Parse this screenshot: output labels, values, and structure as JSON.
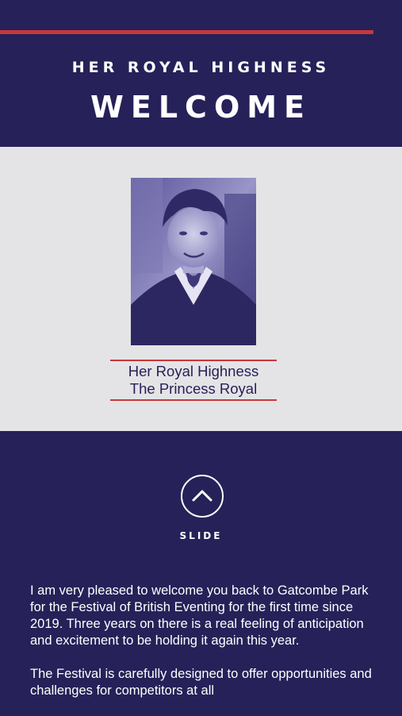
{
  "header": {
    "supertitle": "HER ROYAL HIGHNESS",
    "title": "WELCOME"
  },
  "portrait": {
    "caption_line1": "Her Royal Highness",
    "caption_line2": "The Princess Royal"
  },
  "slide": {
    "label": "SLIDE",
    "icon": "chevron-up-icon"
  },
  "body": {
    "paragraphs": [
      "I am very pleased to welcome you back to Gatcombe Park for the Festival of British Eventing for the first time since 2019. Three years on there is a real feeling of anticipation and excitement to be holding it again this year.",
      "The Festival is carefully designed to offer opportunities and challenges for competitors at all"
    ]
  },
  "colors": {
    "navy": "#262158",
    "accent_red": "#c8373a",
    "panel_grey": "#e4e4e6"
  }
}
